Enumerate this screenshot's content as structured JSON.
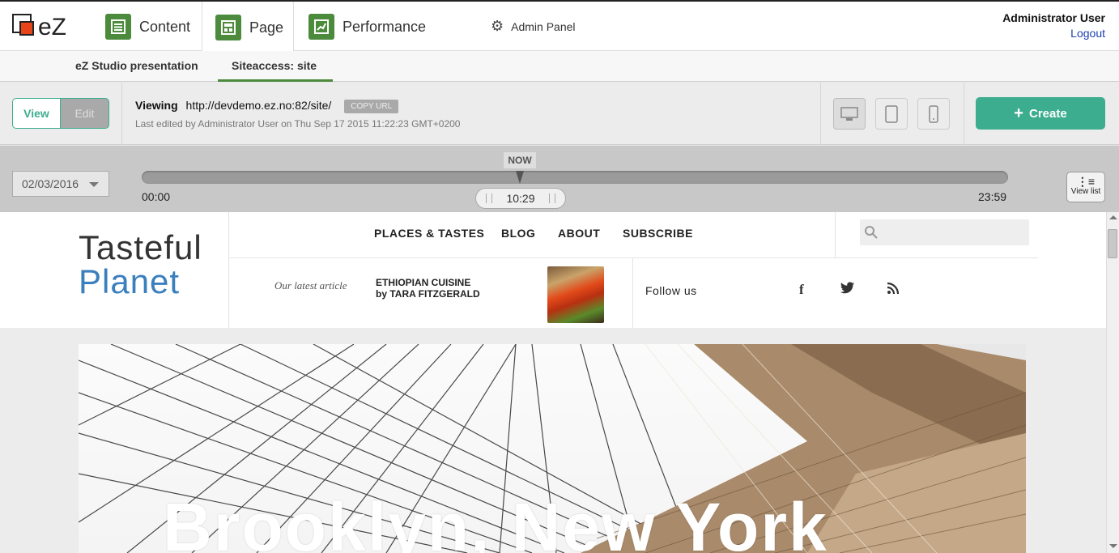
{
  "topbar": {
    "logo_text": "eZ",
    "tabs": [
      {
        "label": "Content",
        "icon": "list-icon"
      },
      {
        "label": "Page",
        "icon": "layout-icon"
      },
      {
        "label": "Performance",
        "icon": "chart-icon"
      }
    ],
    "admin_label": "Admin Panel",
    "user_name": "Administrator User",
    "logout_label": "Logout"
  },
  "subbar": {
    "items": [
      "eZ Studio presentation",
      "Siteaccess: site"
    ]
  },
  "toolbar": {
    "view_label": "View",
    "edit_label": "Edit",
    "viewing_label": "Viewing",
    "url": "http://devdemo.ez.no:82/site/",
    "copy_url_label": "COPY URL",
    "last_edited": "Last edited by Administrator User on Thu Sep 17 2015 11:22:23 GMT+0200",
    "create_label": "Create"
  },
  "timeline": {
    "date": "02/03/2016",
    "now_label": "NOW",
    "start": "00:00",
    "end": "23:59",
    "current": "10:29",
    "view_list_label": "View list"
  },
  "site": {
    "brand_line1": "Tasteful",
    "brand_line2": "Planet",
    "menu": [
      "PLACES & TASTES",
      "BLOG",
      "ABOUT",
      "SUBSCRIBE"
    ],
    "latest_label": "Our latest article",
    "article_title": "ETHIOPIAN CUISINE",
    "article_author": "by TARA FITZGERALD",
    "follow_label": "Follow us",
    "social": [
      "facebook-icon",
      "twitter-icon",
      "rss-icon"
    ],
    "hero_title": "Brooklyn, New York"
  },
  "colors": {
    "accent_green": "#4c8a3c",
    "create_teal": "#3dad8f",
    "brand_blue": "#3a7fbe"
  }
}
